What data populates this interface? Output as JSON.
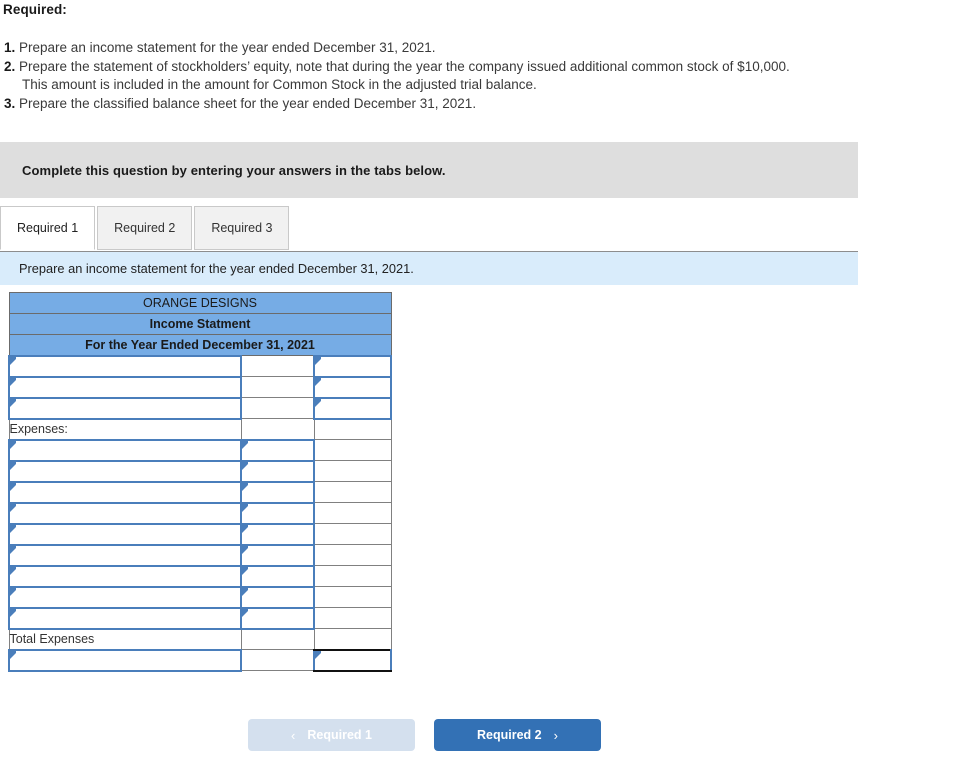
{
  "required": {
    "heading": "Required:",
    "items": [
      {
        "num": "1.",
        "text": "Prepare an income statement for the year ended December 31, 2021.",
        "cont": ""
      },
      {
        "num": "2.",
        "text": "Prepare the statement of stockholders’ equity, note that during the year the company issued additional common stock of $10,000.",
        "cont": "This amount is included in the amount for Common Stock in the adjusted trial balance."
      },
      {
        "num": "3.",
        "text": "Prepare the classified balance sheet for the year ended December 31, 2021.",
        "cont": ""
      }
    ]
  },
  "complete_banner": {
    "text": "Complete this question by entering your answers in the tabs below."
  },
  "tabs": [
    {
      "label": "Required 1",
      "active": true
    },
    {
      "label": "Required 2",
      "active": false
    },
    {
      "label": "Required 3",
      "active": false
    }
  ],
  "instruction": {
    "text": "Prepare an income statement for the year ended December 31, 2021."
  },
  "worksheet": {
    "header_lines": [
      "ORANGE DESIGNS",
      "Income Statment",
      "For the Year Ended December 31, 2021"
    ],
    "labels": {
      "expenses": "Expenses:",
      "total_expenses": "Total Expenses"
    },
    "revenue_row_count": 3,
    "expense_row_count": 9,
    "cell_values": {
      "revenue_rows": [
        {
          "c1": "",
          "c2": "",
          "c3": ""
        },
        {
          "c1": "",
          "c2": "",
          "c3": ""
        },
        {
          "c1": "",
          "c2": "",
          "c3": ""
        }
      ],
      "expense_rows": [
        {
          "c1": "",
          "c2": "",
          "c3": ""
        },
        {
          "c1": "",
          "c2": "",
          "c3": ""
        },
        {
          "c1": "",
          "c2": "",
          "c3": ""
        },
        {
          "c1": "",
          "c2": "",
          "c3": ""
        },
        {
          "c1": "",
          "c2": "",
          "c3": ""
        },
        {
          "c1": "",
          "c2": "",
          "c3": ""
        },
        {
          "c1": "",
          "c2": "",
          "c3": ""
        },
        {
          "c1": "",
          "c2": "",
          "c3": ""
        },
        {
          "c1": "",
          "c2": "",
          "c3": ""
        }
      ],
      "total_expenses_row": {
        "c2": "",
        "c3": ""
      },
      "net_income_row": {
        "c1": "",
        "c2": "",
        "c3": ""
      }
    }
  },
  "nav": {
    "prev_label": "Required 1",
    "next_label": "Required 2",
    "prev_chevron": "‹",
    "next_chevron": "›"
  },
  "colors": {
    "header_blue": "#76ace5",
    "instruction_blue": "#d9ecfb",
    "banner_gray": "#dedede",
    "input_border_blue": "#4a7ebb",
    "button_active_blue": "#3371b5",
    "button_disabled_blue": "#d4e0ee"
  }
}
